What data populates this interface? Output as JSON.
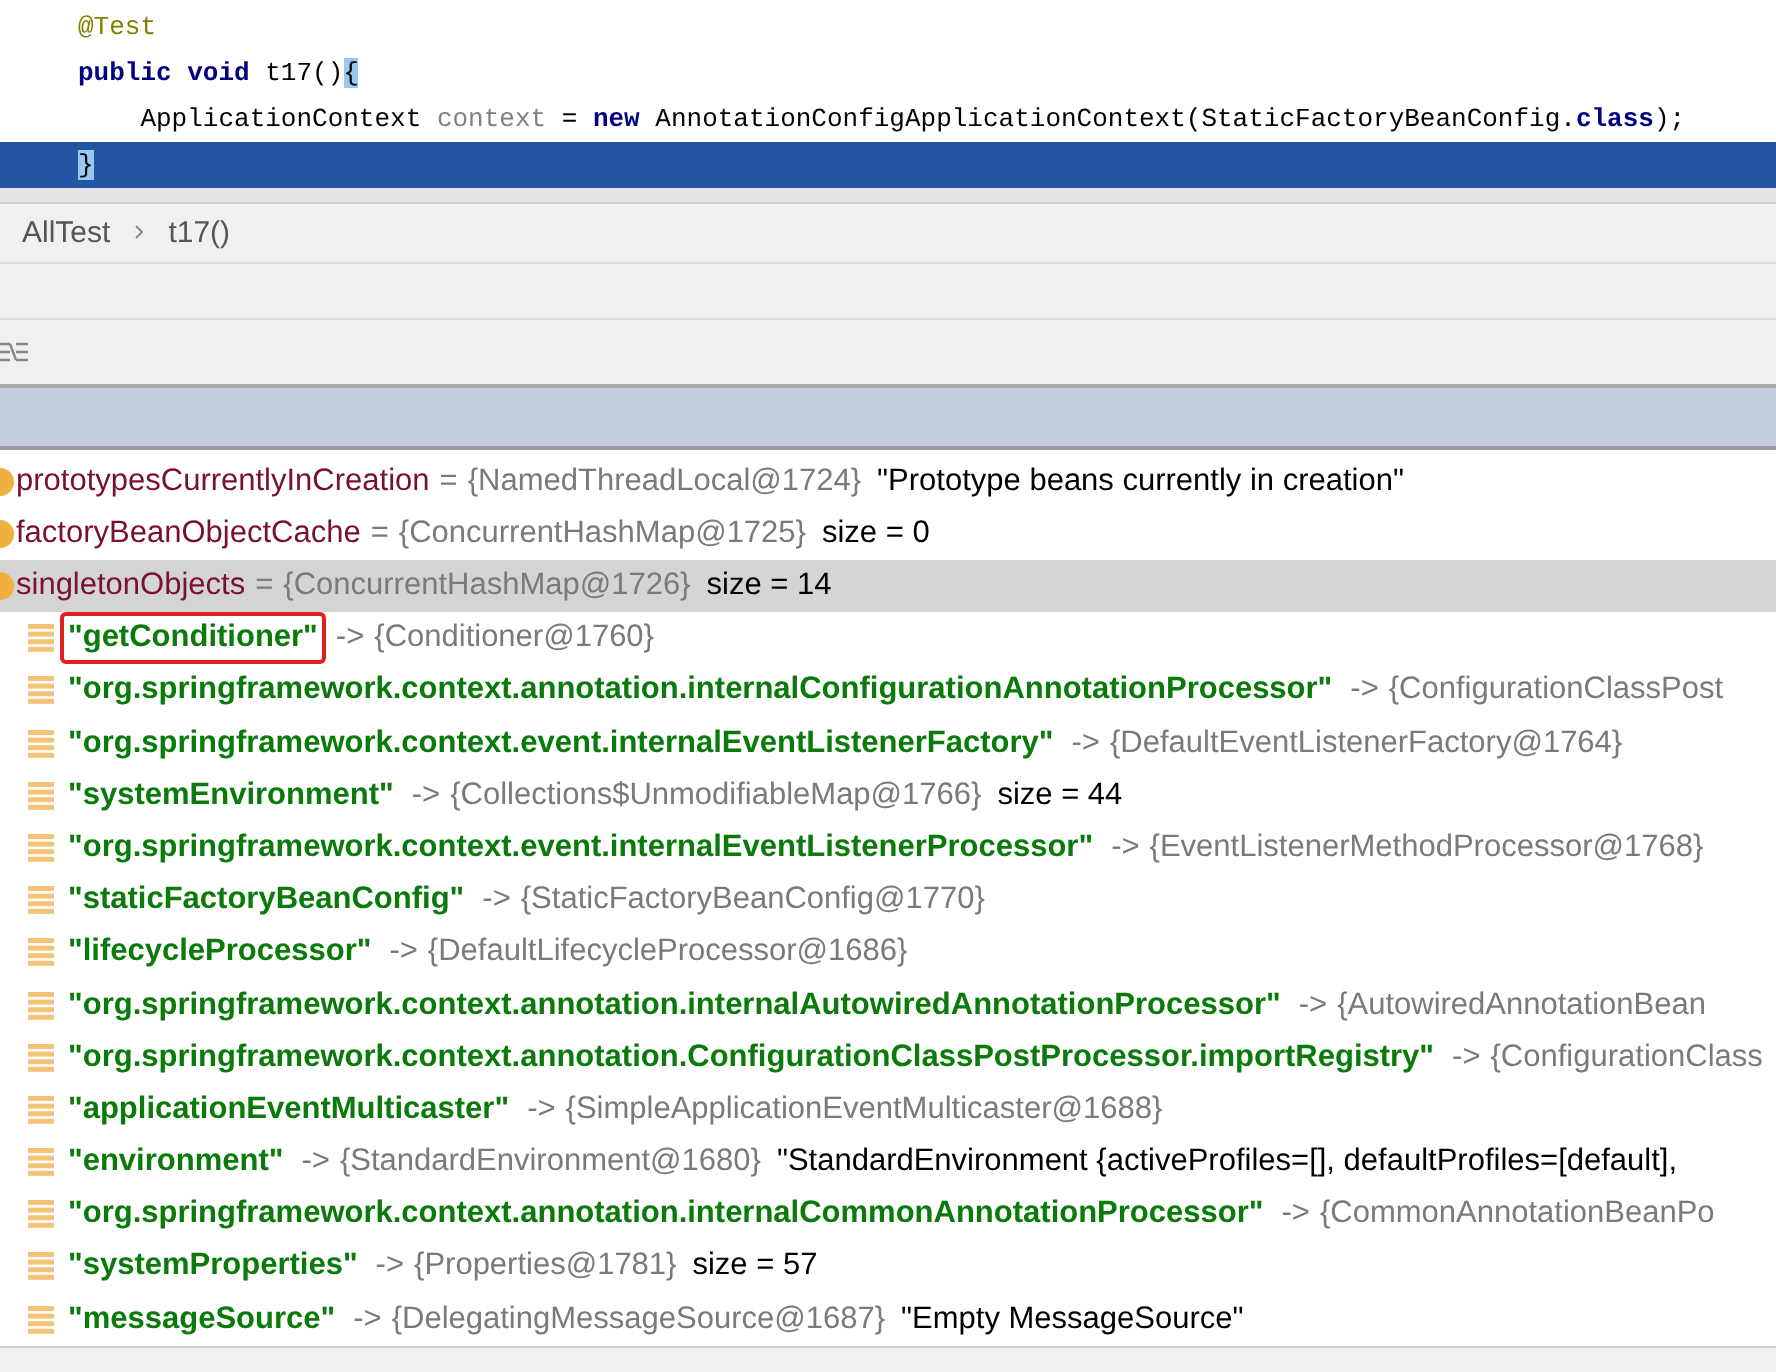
{
  "editor": {
    "lines": [
      {
        "current": false,
        "tokens": [
          {
            "kind": "annotation",
            "text": "@Test"
          }
        ]
      },
      {
        "current": false,
        "tokens": [
          {
            "kind": "keyword",
            "text": "public void"
          },
          {
            "kind": "plain",
            "text": " t17()"
          },
          {
            "kind": "brace",
            "text": "{"
          }
        ]
      },
      {
        "current": false,
        "tokens": [
          {
            "kind": "plain",
            "text": "    ApplicationContext "
          },
          {
            "kind": "muted",
            "text": "context"
          },
          {
            "kind": "plain",
            "text": " = "
          },
          {
            "kind": "keyword",
            "text": "new"
          },
          {
            "kind": "plain",
            "text": " AnnotationConfigApplicationContext(StaticFactoryBeanConfig."
          },
          {
            "kind": "keyword",
            "text": "class"
          },
          {
            "kind": "plain",
            "text": ");"
          }
        ]
      },
      {
        "current": true,
        "tokens": [
          {
            "kind": "brace",
            "text": "}"
          }
        ]
      }
    ]
  },
  "breadcrumb": [
    "AllTest",
    "t17()"
  ],
  "variables": [
    {
      "name": "prototypesCurrentlyInCreation",
      "sep": "=",
      "value": "{NamedThreadLocal@1724}",
      "extra": "\"Prototype beans currently in creation\"",
      "selected": false
    },
    {
      "name": "factoryBeanObjectCache",
      "sep": "=",
      "value": "{ConcurrentHashMap@1725}",
      "extra": "size = 0",
      "selected": false
    },
    {
      "name": "singletonObjects",
      "sep": "=",
      "value": "{ConcurrentHashMap@1726}",
      "extra": "size = 14",
      "selected": true,
      "children": [
        {
          "key": "\"getConditioner\"",
          "sep": "->",
          "value": "{Conditioner@1760}",
          "highlighted": true
        },
        {
          "key": "\"org.springframework.context.annotation.internalConfigurationAnnotationProcessor\"",
          "sep": "->",
          "value": "{ConfigurationClassPost",
          "highlighted": false
        },
        {
          "key": "\"org.springframework.context.event.internalEventListenerFactory\"",
          "sep": "->",
          "value": "{DefaultEventListenerFactory@1764}",
          "highlighted": false
        },
        {
          "key": "\"systemEnvironment\"",
          "sep": "->",
          "value": "{Collections$UnmodifiableMap@1766}",
          "extra": "size = 44",
          "highlighted": false
        },
        {
          "key": "\"org.springframework.context.event.internalEventListenerProcessor\"",
          "sep": "->",
          "value": "{EventListenerMethodProcessor@1768}",
          "highlighted": false
        },
        {
          "key": "\"staticFactoryBeanConfig\"",
          "sep": "->",
          "value": "{StaticFactoryBeanConfig@1770}",
          "highlighted": false
        },
        {
          "key": "\"lifecycleProcessor\"",
          "sep": "->",
          "value": "{DefaultLifecycleProcessor@1686}",
          "highlighted": false
        },
        {
          "key": "\"org.springframework.context.annotation.internalAutowiredAnnotationProcessor\"",
          "sep": "->",
          "value": "{AutowiredAnnotationBean",
          "highlighted": false
        },
        {
          "key": "\"org.springframework.context.annotation.ConfigurationClassPostProcessor.importRegistry\"",
          "sep": "->",
          "value": "{ConfigurationClass",
          "highlighted": false
        },
        {
          "key": "\"applicationEventMulticaster\"",
          "sep": "->",
          "value": "{SimpleApplicationEventMulticaster@1688}",
          "highlighted": false
        },
        {
          "key": "\"environment\"",
          "sep": "->",
          "value": "{StandardEnvironment@1680}",
          "extra": "\"StandardEnvironment {activeProfiles=[], defaultProfiles=[default],",
          "highlighted": false
        },
        {
          "key": "\"org.springframework.context.annotation.internalCommonAnnotationProcessor\"",
          "sep": "->",
          "value": "{CommonAnnotationBeanPo",
          "highlighted": false
        },
        {
          "key": "\"systemProperties\"",
          "sep": "->",
          "value": "{Properties@1781}",
          "extra": "size = 57",
          "highlighted": false
        },
        {
          "key": "\"messageSource\"",
          "sep": "->",
          "value": "{DelegatingMessageSource@1687}",
          "extra": "\"Empty MessageSource\"",
          "highlighted": false
        }
      ]
    }
  ]
}
